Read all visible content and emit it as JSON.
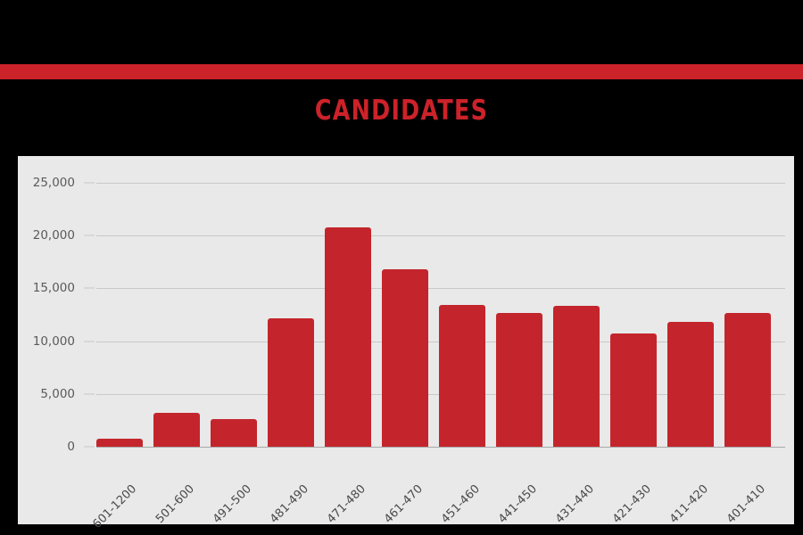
{
  "slide": {
    "background_color": "#000000",
    "accent_bar_color": "#CC2229",
    "panel_color": "#E9E9E9",
    "title": "CANDIDATES"
  },
  "chart_data": {
    "type": "bar",
    "title": "CANDIDATES",
    "xlabel": "",
    "ylabel": "",
    "categories": [
      "601-1200",
      "501-600",
      "491-500",
      "481-490",
      "471-480",
      "461-470",
      "451-460",
      "441-450",
      "431-440",
      "421-430",
      "411-420",
      "401-410"
    ],
    "values": [
      800,
      3200,
      2600,
      12200,
      20800,
      16800,
      13400,
      12700,
      13350,
      10700,
      11800,
      12700
    ],
    "ylim": [
      0,
      25000
    ],
    "ytick_labels": [
      "0",
      "5,000",
      "10,000",
      "15,000",
      "20,000",
      "25,000"
    ],
    "ytick_values": [
      0,
      5000,
      10000,
      15000,
      20000,
      25000
    ],
    "grid": true,
    "legend": false,
    "bar_color": "#C4252C",
    "gridline_color": "#C8C8C8",
    "axis_text_color": "#4A4A4A"
  }
}
